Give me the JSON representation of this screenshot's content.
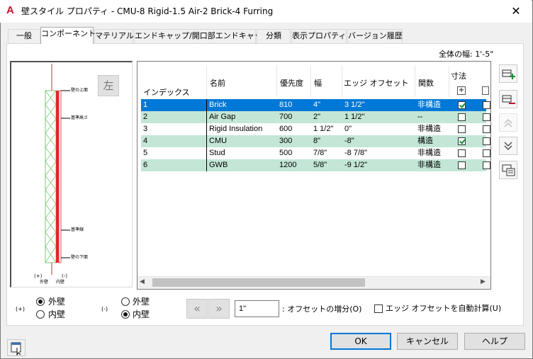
{
  "window": {
    "title": "壁スタイル プロパティ - CMU-8 Rigid-1.5 Air-2 Brick-4 Furring",
    "app_icon": "A",
    "close": "✕"
  },
  "tabs": [
    {
      "label": "一般"
    },
    {
      "label": "コンポーネント"
    },
    {
      "label": "マテリアル"
    },
    {
      "label": "エンドキャップ/開口部エンドキャップ"
    },
    {
      "label": "分類"
    },
    {
      "label": "表示プロパティ"
    },
    {
      "label": "バージョン履歴"
    }
  ],
  "width_label": "全体の幅: 1'-5\"",
  "preview": {
    "flip_label": "左",
    "labels": [
      "壁の上面",
      "基準高さ",
      "基準線",
      "壁の下面"
    ],
    "plus": "(+)",
    "minus": "(-)",
    "exterior": "外壁",
    "interior": "内壁"
  },
  "grid": {
    "headers": {
      "index": "インデックス",
      "name": "名前",
      "priority": "優先度",
      "width": "幅",
      "edge_offset": "エッジ オフセット",
      "function": "関数",
      "dims": "寸法"
    },
    "rows": [
      {
        "index": "1",
        "name": "Brick",
        "priority": "810",
        "width": "4\"",
        "offset": "3 1/2\"",
        "function": "非構造",
        "dim": true
      },
      {
        "index": "2",
        "name": "Air Gap",
        "priority": "700",
        "width": "2\"",
        "offset": "1 1/2\"",
        "function": "--",
        "dim": false
      },
      {
        "index": "3",
        "name": "Rigid Insulation",
        "priority": "600",
        "width": "1 1/2\"",
        "offset": "0\"",
        "function": "非構造",
        "dim": false
      },
      {
        "index": "4",
        "name": "CMU",
        "priority": "300",
        "width": "8\"",
        "offset": "-8\"",
        "function": "構造",
        "dim": true
      },
      {
        "index": "5",
        "name": "Stud",
        "priority": "500",
        "width": "7/8\"",
        "offset": "-8 7/8\"",
        "function": "非構造",
        "dim": false
      },
      {
        "index": "6",
        "name": "GWB",
        "priority": "1200",
        "width": "5/8\"",
        "offset": "-9 1/2\"",
        "function": "非構造",
        "dim": false
      }
    ]
  },
  "bottom": {
    "plus_label": "(+)",
    "minus_label": "(-)",
    "exterior": "外壁",
    "interior": "内壁",
    "offset_value": "1\"",
    "offset_label": ": オフセットの増分(O)",
    "auto_calc_label": "エッジ オフセットを自動計算(U)",
    "prev": "«",
    "next": "»"
  },
  "buttons": {
    "ok": "OK",
    "cancel": "キャンセル",
    "help": "ヘルプ"
  },
  "colors": {
    "selected_row": "#0078d7",
    "alt_row": "#c3e6d6",
    "wall_red": "#e3262b",
    "wall_green": "#7cc576"
  }
}
